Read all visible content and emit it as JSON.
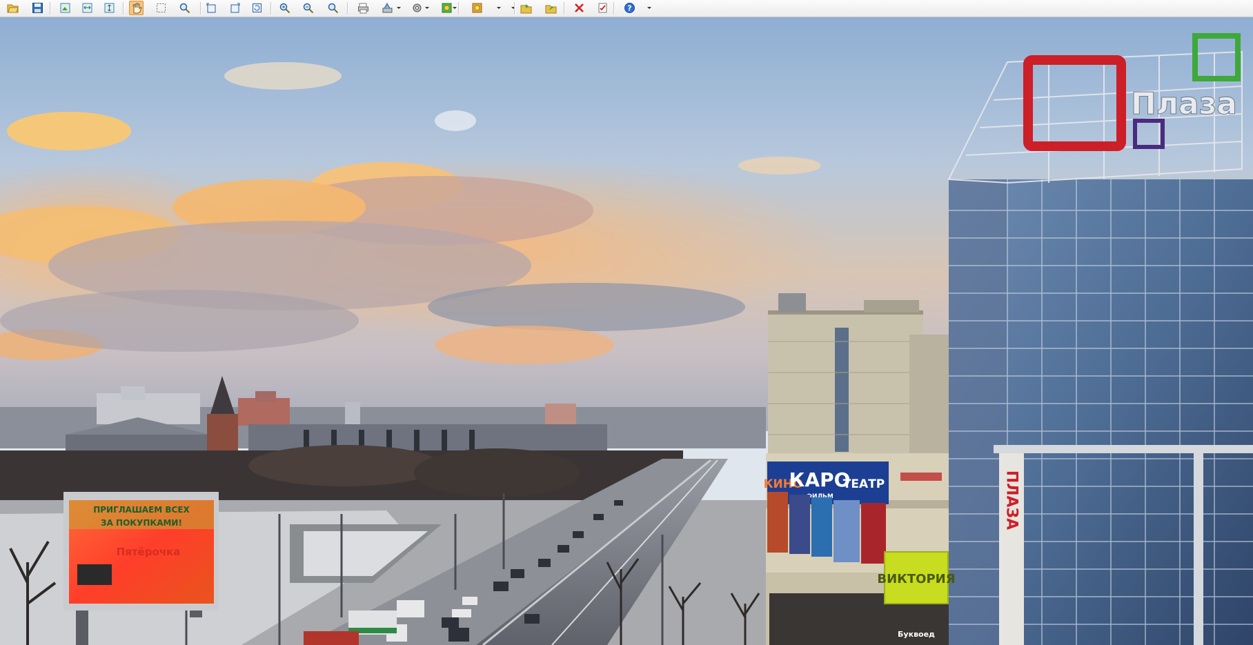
{
  "toolbar": {
    "buttons": [
      {
        "name": "open-button",
        "icon": "open-folder-icon"
      },
      {
        "name": "save-button",
        "icon": "floppy-disk-icon"
      },
      {
        "name": "fit-window-button",
        "icon": "fit-window-icon"
      },
      {
        "name": "fit-width-button",
        "icon": "fit-width-icon"
      },
      {
        "name": "fit-height-button",
        "icon": "fit-height-icon"
      },
      {
        "name": "hand-tool-button",
        "icon": "hand-icon",
        "active": true
      },
      {
        "name": "select-tool-button",
        "icon": "select-icon"
      },
      {
        "name": "zoom-tool-button",
        "icon": "magnifier-icon"
      },
      {
        "name": "rotate-left-button",
        "icon": "rotate-left-icon"
      },
      {
        "name": "rotate-right-button",
        "icon": "rotate-right-icon"
      },
      {
        "name": "refresh-button",
        "icon": "refresh-icon"
      },
      {
        "name": "zoom-in-button",
        "icon": "zoom-in-icon"
      },
      {
        "name": "zoom-out-button",
        "icon": "zoom-out-icon"
      },
      {
        "name": "zoom-options-button",
        "icon": "zoom-menu-icon"
      },
      {
        "name": "print-button",
        "icon": "printer-icon"
      },
      {
        "name": "scan-button",
        "icon": "scanner-icon"
      },
      {
        "name": "settings-button",
        "icon": "gear-icon"
      },
      {
        "name": "effects-button",
        "icon": "effects-icon"
      },
      {
        "name": "adjust-button",
        "icon": "adjust-icon"
      },
      {
        "name": "copy-to-folder-button",
        "icon": "copy-folder-icon"
      },
      {
        "name": "move-to-folder-button",
        "icon": "move-folder-icon"
      },
      {
        "name": "delete-button",
        "icon": "red-x-icon"
      },
      {
        "name": "properties-button",
        "icon": "checklist-icon"
      },
      {
        "name": "help-button",
        "icon": "help-icon"
      }
    ],
    "colors": {
      "accent": "#f6c483",
      "bar": "#efefef"
    }
  },
  "photo": {
    "signs": {
      "roof_brand": "Плаза",
      "cinema_left": "КИНО",
      "cinema_mid": "КАРО",
      "cinema_sub": "ФИЛЬМ",
      "cinema_right": "ТЕАТР",
      "store": "ВИКТОРИЯ",
      "vertical": "ПЛАЗА",
      "billboard_line1": "ПРИГЛАШАЕМ ВСЕХ",
      "billboard_line2": "ЗА ПОКУПКАМИ!",
      "billboard_brand": "Пятёрочка",
      "small_sign": "Буквоед"
    },
    "colors": {
      "sky_top": "#8fb0d4",
      "sky_glow": "#f5c58a",
      "glass": "#5d7da4",
      "plaza_red": "#cc1f28",
      "plaza_green": "#3ea83a",
      "cinema_blue": "#1c3f94",
      "victoria": "#c8dc20"
    }
  }
}
